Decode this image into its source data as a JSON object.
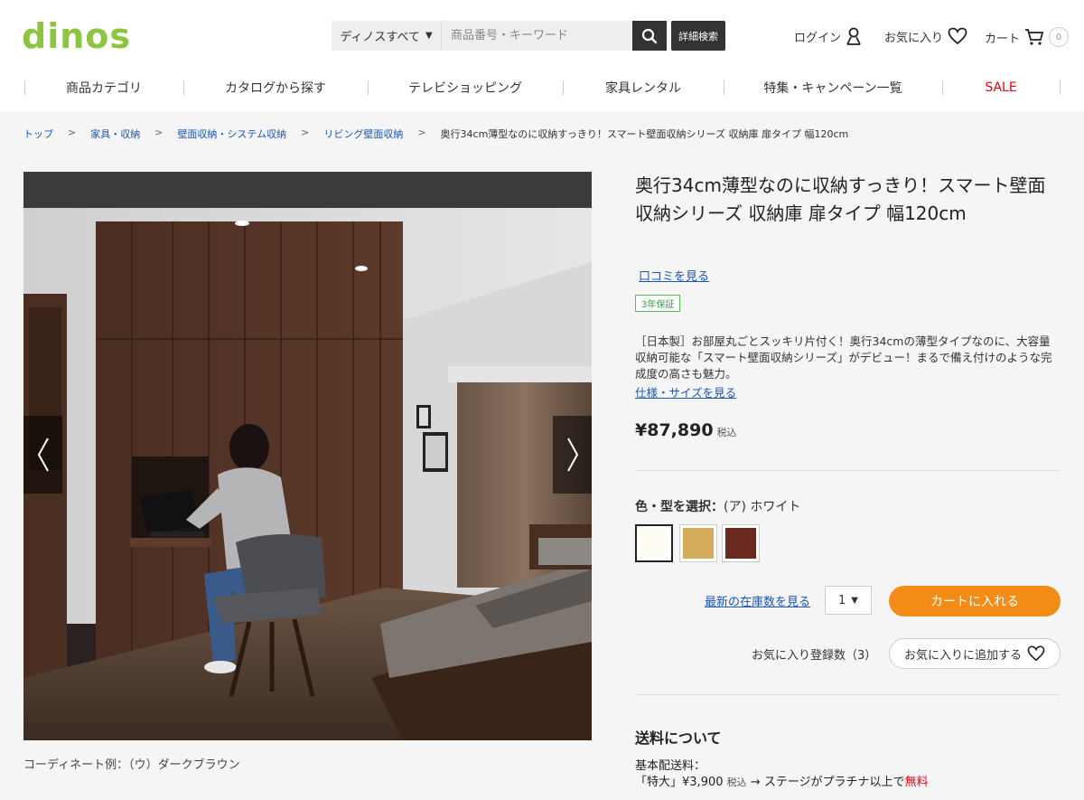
{
  "header": {
    "logo": "dinos",
    "search_scope": "ディノスすべて",
    "search_placeholder": "商品番号・キーワード",
    "advanced_search": "詳細検索",
    "login": "ログイン",
    "favorites": "お気に入り",
    "cart": "カート",
    "cart_count": "0"
  },
  "nav": {
    "items": [
      "商品カテゴリ",
      "カタログから探す",
      "テレビショッピング",
      "家具レンタル",
      "特集・キャンペーン一覧",
      "SALE"
    ]
  },
  "breadcrumb": {
    "items": [
      "トップ",
      "家具・収納",
      "壁面収納・システム収納",
      "リビング壁面収納"
    ],
    "current": "奥行34cm薄型なのに収納すっきり！スマート壁面収納シリーズ 収納庫 扉タイプ 幅120cm"
  },
  "gallery": {
    "caption": "コーディネート例：（ウ）ダークブラウン"
  },
  "product": {
    "title": "奥行34cm薄型なのに収納すっきり！スマート壁面収納シリーズ 収納庫 扉タイプ 幅120cm",
    "review_link": "口コミを見る",
    "warranty_badge": "3年保証",
    "description": "［日本製］お部屋丸ごとスッキリ片付く！奥行34cmの薄型タイプなのに、大容量収納可能な「スマート壁面収納シリーズ」がデビュー！まるで備え付けのような完成度の高さも魅力。",
    "spec_link": "仕様・サイズを見る",
    "price": "¥87,890",
    "tax_label": "税込",
    "color_label": "色・型を選択：",
    "color_selected": "(ア) ホワイト",
    "swatches": [
      {
        "color": "#fffdf3"
      },
      {
        "color": "#d4ac5a"
      },
      {
        "color": "#6b2a1f"
      }
    ],
    "stock_link": "最新の在庫数を見る",
    "quantity": "1",
    "add_to_cart": "カートに入れる",
    "favorite_count_label": "お気に入り登録数（3）",
    "add_to_favorites": "お気に入りに追加する"
  },
  "shipping": {
    "title": "送料について",
    "base_label": "基本配送料：",
    "size_label": "「特大」",
    "fee": "¥3,900",
    "fee_tax": "税込",
    "condition": "→ ステージがプラチナ以上で",
    "free": "無料"
  },
  "colors": {
    "brand_green": "#8cc63f",
    "link_blue": "#1a56b8",
    "cart_orange": "#f28c16",
    "sale_red": "#e60012"
  }
}
